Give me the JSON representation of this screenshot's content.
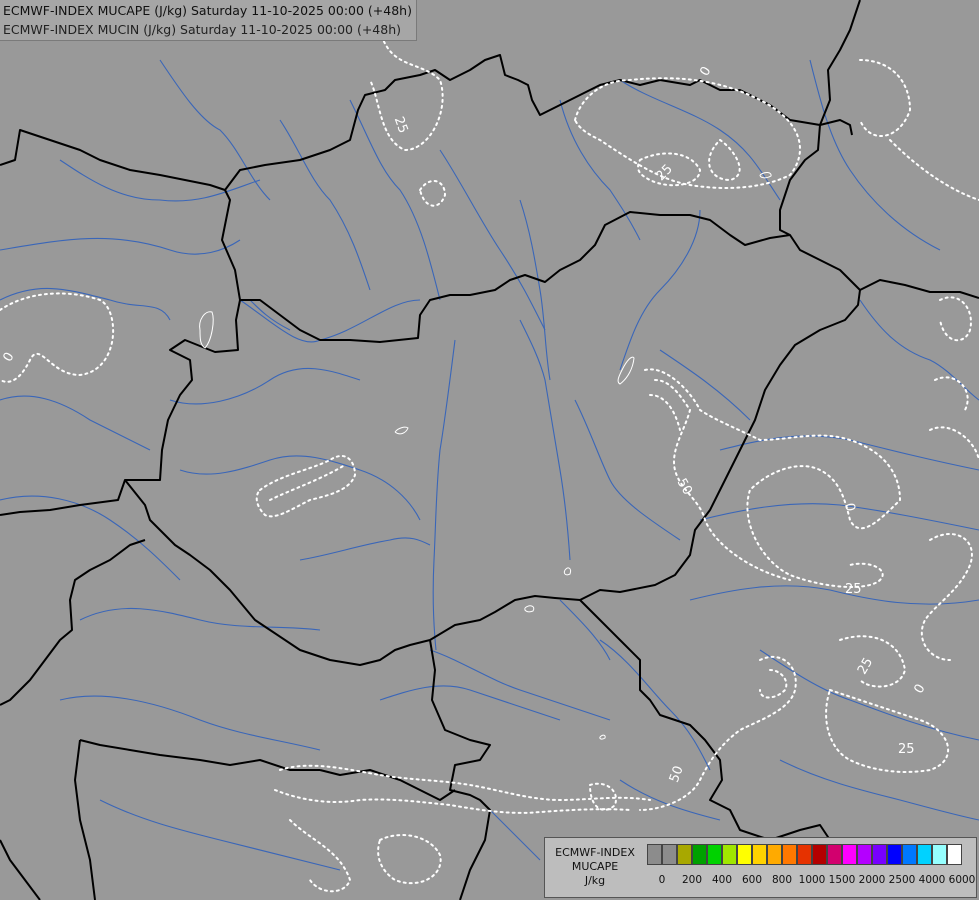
{
  "header": {
    "line1": "ECMWF-INDEX MUCAPE (J/kg) Saturday 11-10-2025 00:00 (+48h)",
    "line2": "ECMWF-INDEX MUCIN (J/kg) Saturday 11-10-2025 00:00 (+48h)"
  },
  "map": {
    "background_color": "#999999",
    "border_color": "#000000",
    "river_color": "#3a66b8",
    "contour_color": "#ffffff",
    "contour_labels": [
      "25",
      "0",
      "25",
      "0",
      "50",
      "25",
      "0",
      "25",
      "0",
      "25",
      "50"
    ]
  },
  "legend": {
    "name_line1": "ECMWF-INDEX",
    "name_line2": "MUCAPE",
    "unit": "J/kg",
    "colors": [
      "#8c8c8c",
      "#8c8c8c",
      "#a8a800",
      "#00a000",
      "#00d200",
      "#a0e600",
      "#ffff00",
      "#ffd200",
      "#ffaa00",
      "#ff7800",
      "#e63200",
      "#b40000",
      "#d2006e",
      "#ff00ff",
      "#b400ff",
      "#7800ff",
      "#0000ff",
      "#0078ff",
      "#00d2ff",
      "#96ffff",
      "#ffffff"
    ],
    "ticks": [
      "0",
      "200",
      "400",
      "600",
      "800",
      "1000",
      "1500",
      "2000",
      "2500",
      "4000",
      "6000"
    ]
  }
}
